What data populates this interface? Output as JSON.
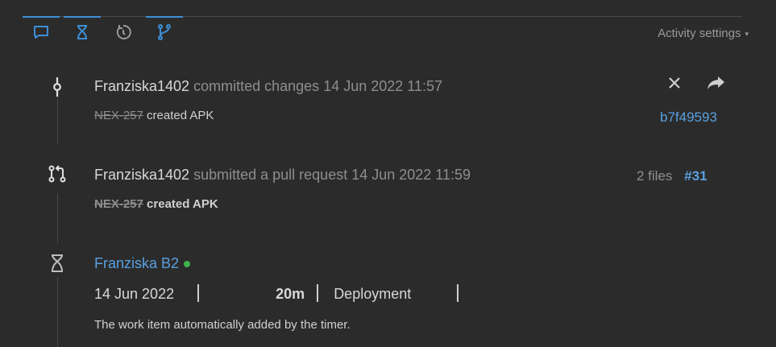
{
  "tabs": [
    {
      "icon": "comment-icon",
      "active": true
    },
    {
      "icon": "hourglass-icon",
      "active": true
    },
    {
      "icon": "history-icon",
      "active": false
    },
    {
      "icon": "vcs-branch-icon",
      "active": true
    }
  ],
  "settings": {
    "label": "Activity settings",
    "caret": "▾"
  },
  "events": {
    "commit": {
      "icon": "commit-icon",
      "author": "Franziska1402",
      "action": "committed changes",
      "datetime": "14 Jun 2022 11:57",
      "issue": "NEX-257",
      "message": "created APK",
      "hash": "b7f49593",
      "close_icon": "close-icon",
      "share_icon": "share-icon"
    },
    "pull_request": {
      "icon": "pull-request-icon",
      "author": "Franziska1402",
      "action": "submitted a pull request",
      "datetime": "14 Jun 2022 11:59",
      "files": "2 files",
      "number": "#31",
      "issue": "NEX-257",
      "title": "created APK"
    },
    "work_item": {
      "icon": "hourglass-icon",
      "author": "Franziska B2",
      "date": "14 Jun 2022",
      "duration": "20m",
      "type": "Deployment",
      "description": "The work item automatically added by the timer."
    }
  },
  "colors": {
    "accent": "#3d8fd6",
    "link": "#5aa0e0",
    "online": "#3fb14a",
    "background": "#2b2b2b"
  }
}
